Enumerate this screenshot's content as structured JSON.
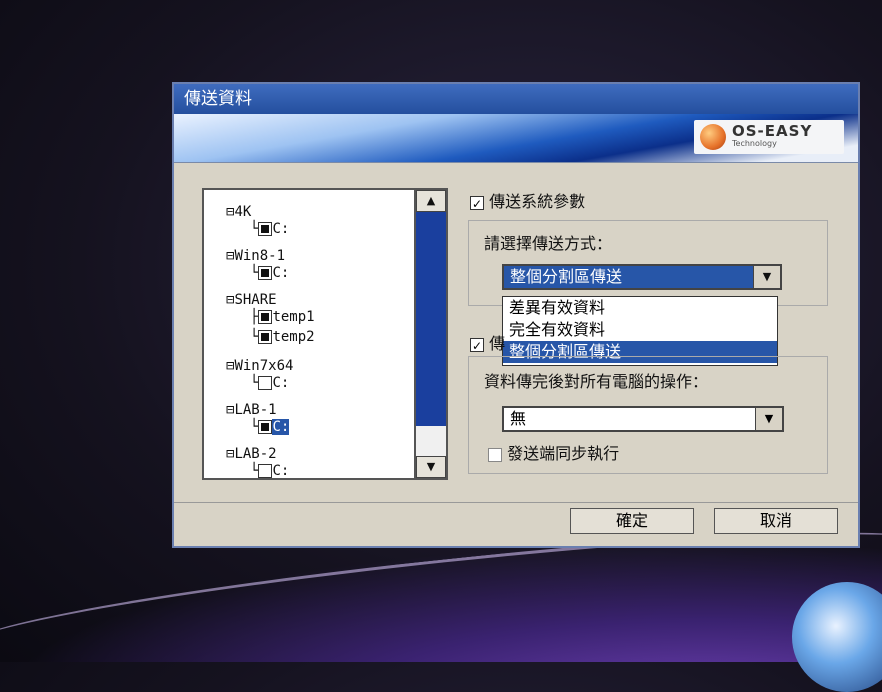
{
  "dialog": {
    "title": "傳送資料",
    "logo": {
      "brand": "OS-EASY",
      "sub": "Technology"
    },
    "tree": {
      "nodes": [
        {
          "label": "4K",
          "child": "C:"
        },
        {
          "label": "Win8-1",
          "child": "C:"
        },
        {
          "label": "SHARE",
          "children": [
            "temp1",
            "temp2"
          ]
        },
        {
          "label": "Win7x64",
          "child": "C:"
        },
        {
          "label": "LAB-1",
          "child": "C:"
        },
        {
          "label": "LAB-2",
          "child": "C:"
        }
      ]
    },
    "options": {
      "send_system_params": "傳送系統參數",
      "send_mode_label": "請選擇傳送方式：",
      "send_mode_selected": "整個分割區傳送",
      "send_mode_options": [
        "差異有效資料",
        "完全有效資料",
        "整個分割區傳送"
      ],
      "after_action_check_partial": "傳",
      "after_action_label": "資料傳完後對所有電腦的操作：",
      "after_action_selected": "無",
      "sender_sync": "發送端同步執行"
    },
    "buttons": {
      "ok": "確定",
      "cancel": "取消"
    }
  },
  "colors": {
    "titlebar": "#2f5db0",
    "selection": "#2756a8"
  }
}
